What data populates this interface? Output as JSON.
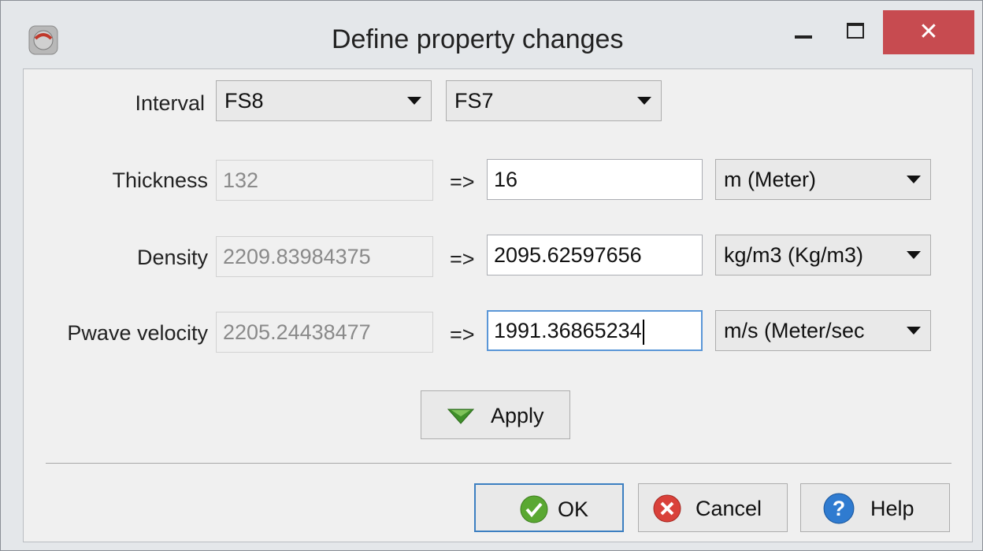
{
  "window": {
    "title": "Define property changes",
    "close_glyph": "✕"
  },
  "interval": {
    "label": "Interval",
    "from": "FS8",
    "to": "FS7"
  },
  "rows": [
    {
      "label": "Thickness",
      "original": "132",
      "arrow": "=>",
      "new_value": "16",
      "unit": "m (Meter)"
    },
    {
      "label": "Density",
      "original": "2209.83984375",
      "arrow": "=>",
      "new_value": "2095.62597656",
      "unit": "kg/m3 (Kg/m3)"
    },
    {
      "label": "Pwave velocity",
      "original": "2205.24438477",
      "arrow": "=>",
      "new_value": "1991.36865234",
      "unit": "m/s (Meter/sec"
    }
  ],
  "buttons": {
    "apply": "Apply",
    "ok": "OK",
    "cancel": "Cancel",
    "help": "Help"
  },
  "icons": {
    "app": "app-logo-icon",
    "apply": "triangle-down-icon",
    "ok": "check-circle-icon",
    "cancel": "x-circle-icon",
    "help": "question-circle-icon"
  },
  "colors": {
    "close_bg": "#c74b50",
    "focus_border": "#5a96d7",
    "ok_green": "#5aa832",
    "cancel_red": "#d9413a",
    "help_blue": "#2f7bd0",
    "apply_green": "#3f8f2a"
  }
}
